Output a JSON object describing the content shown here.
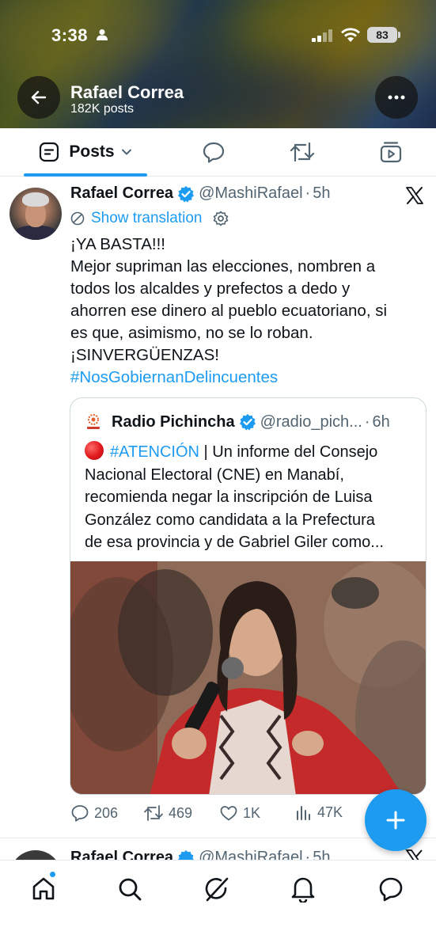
{
  "status_bar": {
    "time": "3:38",
    "battery": "83"
  },
  "profile_header": {
    "name": "Rafael Correa",
    "posts_count": "182K posts"
  },
  "tabs": [
    {
      "label": "Posts",
      "icon": "posts-icon",
      "selected": true
    },
    {
      "label": "",
      "icon": "replies-icon",
      "selected": false
    },
    {
      "label": "",
      "icon": "reposts-icon",
      "selected": false
    },
    {
      "label": "",
      "icon": "media-icon",
      "selected": false
    }
  ],
  "tweet": {
    "author": "Rafael Correa",
    "handle": "@MashiRafael",
    "separator": "·",
    "time": "5h",
    "show_translation": "Show translation",
    "text_lines": [
      "¡YA BASTA!!!",
      "Mejor supriman las elecciones, nombren a",
      "todos los alcaldes y prefectos a dedo y",
      "ahorren ese dinero al pueblo ecuatoriano, si",
      "es que, asimismo, no se lo roban.",
      "¡SINVERGÜENZAS!"
    ],
    "hashtag": "#NosGobiernanDelincuentes",
    "quote": {
      "author": "Radio Pichincha",
      "handle": "@radio_pich...",
      "separator": "·",
      "time": "6h",
      "hashtag": "#ATENCIÓN",
      "text_first_rest": " | Un informe del Consejo",
      "text_lines": [
        "Nacional Electoral (CNE) en Manabí,",
        "recomienda negar la inscripción de Luisa",
        "González como candidata a la Prefectura",
        "de esa provincia y de Gabriel Giler como..."
      ]
    },
    "actions": {
      "replies": "206",
      "reposts": "469",
      "likes": "1K",
      "views": "47K"
    }
  },
  "next_tweet": {
    "author": "Rafael Correa",
    "handle": "@MashiRafael",
    "separator": "·",
    "time": "5h"
  },
  "bottom_nav": [
    {
      "icon": "home-icon"
    },
    {
      "icon": "search-icon"
    },
    {
      "icon": "grok-icon"
    },
    {
      "icon": "bell-icon"
    },
    {
      "icon": "messages-icon"
    }
  ],
  "colors": {
    "accent": "#1d9bf0",
    "text": "#0f1419",
    "secondary_text": "#536471",
    "border": "#cfd9de"
  }
}
